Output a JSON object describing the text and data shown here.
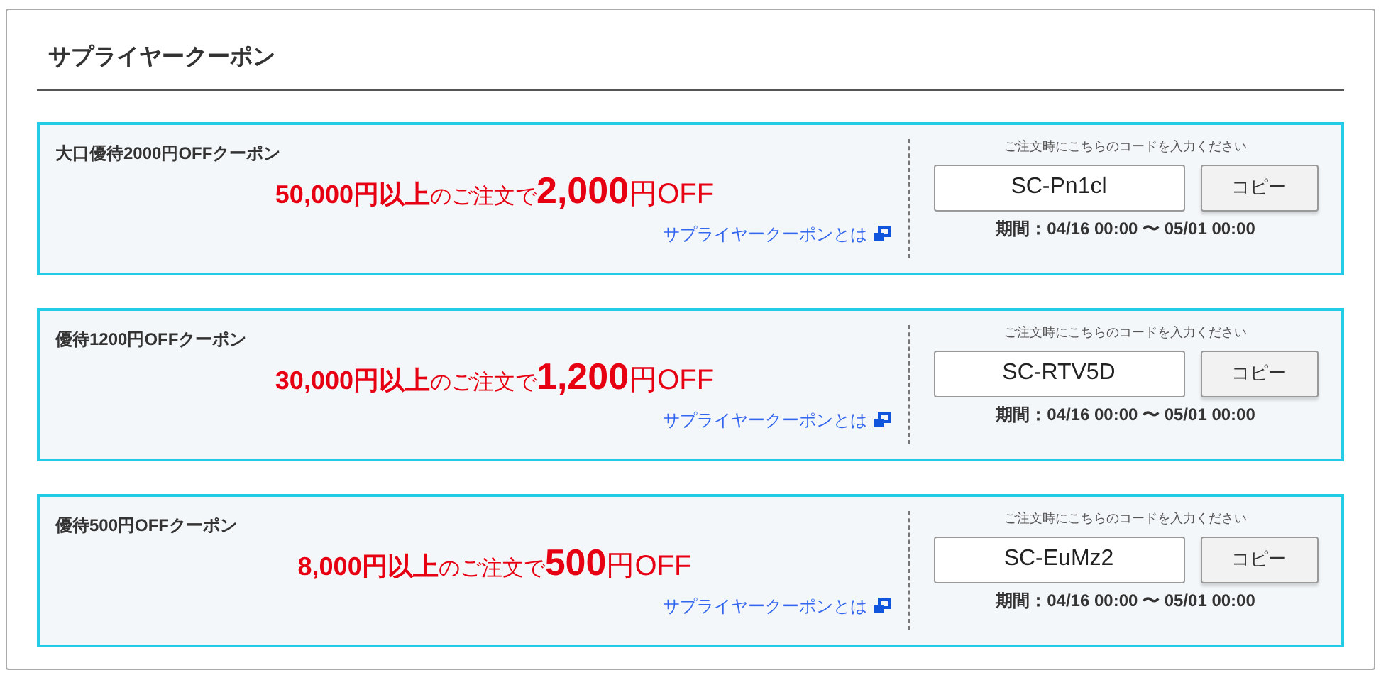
{
  "title": "サプライヤークーポン",
  "coupons": [
    {
      "name": "大口優待2000円OFFクーポン",
      "min_order": "50,000円以上",
      "connector": "のご注文で",
      "discount": "2,000",
      "suffix": "円OFF",
      "link": "サプライヤークーポンとは",
      "instruction": "ご注文時にこちらのコードを入力ください",
      "code": "SC-Pn1cl",
      "copy": "コピー",
      "period": "期間：04/16 00:00 〜 05/01 00:00"
    },
    {
      "name": "優待1200円OFFクーポン",
      "min_order": "30,000円以上",
      "connector": "のご注文で",
      "discount": "1,200",
      "suffix": "円OFF",
      "link": "サプライヤークーポンとは",
      "instruction": "ご注文時にこちらのコードを入力ください",
      "code": "SC-RTV5D",
      "copy": "コピー",
      "period": "期間：04/16 00:00 〜 05/01 00:00"
    },
    {
      "name": "優待500円OFFクーポン",
      "min_order": "8,000円以上",
      "connector": "のご注文で",
      "discount": "500",
      "suffix": "円OFF",
      "link": "サプライヤークーポンとは",
      "instruction": "ご注文時にこちらのコードを入力ください",
      "code": "SC-EuMz2",
      "copy": "コピー",
      "period": "期間：04/16 00:00 〜 05/01 00:00"
    }
  ]
}
